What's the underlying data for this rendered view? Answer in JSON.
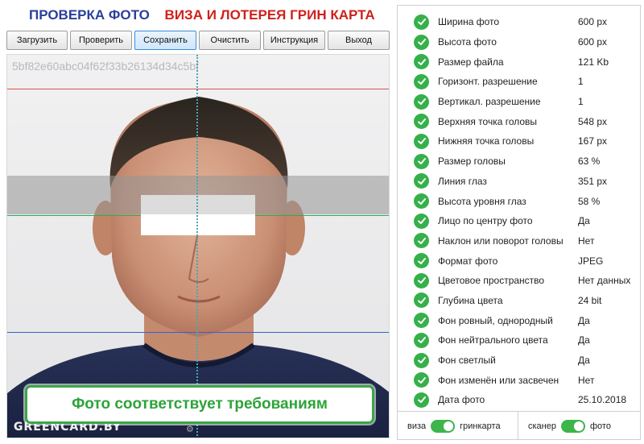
{
  "header": {
    "title_left": "ПРОВЕРКА ФОТО",
    "title_right": "ВИЗА И ЛОТЕРЕЯ ГРИН КАРТА"
  },
  "toolbar": {
    "buttons": [
      {
        "label": "Загрузить"
      },
      {
        "label": "Проверить"
      },
      {
        "label": "Сохранить",
        "active": true
      },
      {
        "label": "Очистить"
      },
      {
        "label": "Инструкция"
      },
      {
        "label": "Выход"
      }
    ]
  },
  "photo": {
    "hash": "5bf82e60abc04f62f33b26134d34c5bf",
    "status_message": "Фото соответствует требованиям",
    "watermark": "GREENCARD.BY"
  },
  "checks": [
    {
      "label": "Ширина фото",
      "value": "600 px"
    },
    {
      "label": "Высота фото",
      "value": "600 px"
    },
    {
      "label": "Размер файла",
      "value": "121 Kb"
    },
    {
      "label": "Горизонт. разрешение",
      "value": "1"
    },
    {
      "label": "Вертикал. разрешение",
      "value": "1"
    },
    {
      "label": "Верхняя точка головы",
      "value": "548 px"
    },
    {
      "label": "Нижняя точка головы",
      "value": "167 px"
    },
    {
      "label": "Размер головы",
      "value": "63 %"
    },
    {
      "label": "Линия глаз",
      "value": "351 px"
    },
    {
      "label": "Высота уровня глаз",
      "value": "58 %"
    },
    {
      "label": "Лицо по центру фото",
      "value": "Да"
    },
    {
      "label": "Наклон или поворот головы",
      "value": "Нет"
    },
    {
      "label": "Формат фото",
      "value": "JPEG"
    },
    {
      "label": "Цветовое пространство",
      "value": "Нет данных"
    },
    {
      "label": "Глубина цвета",
      "value": "24 bit"
    },
    {
      "label": "Фон ровный, однородный",
      "value": "Да"
    },
    {
      "label": "Фон нейтрального цвета",
      "value": "Да"
    },
    {
      "label": "Фон светлый",
      "value": "Да"
    },
    {
      "label": "Фон изменён или засвечен",
      "value": "Нет"
    },
    {
      "label": "Дата фото",
      "value": "25.10.2018"
    }
  ],
  "footer": {
    "mode_left": "виза",
    "mode_right": "гринкарта",
    "source_left": "сканер",
    "source_right": "фото"
  },
  "colors": {
    "title_blue": "#2b3f9a",
    "title_red": "#d0201c",
    "check_green": "#36b04a",
    "status_green": "#2ea33a"
  }
}
